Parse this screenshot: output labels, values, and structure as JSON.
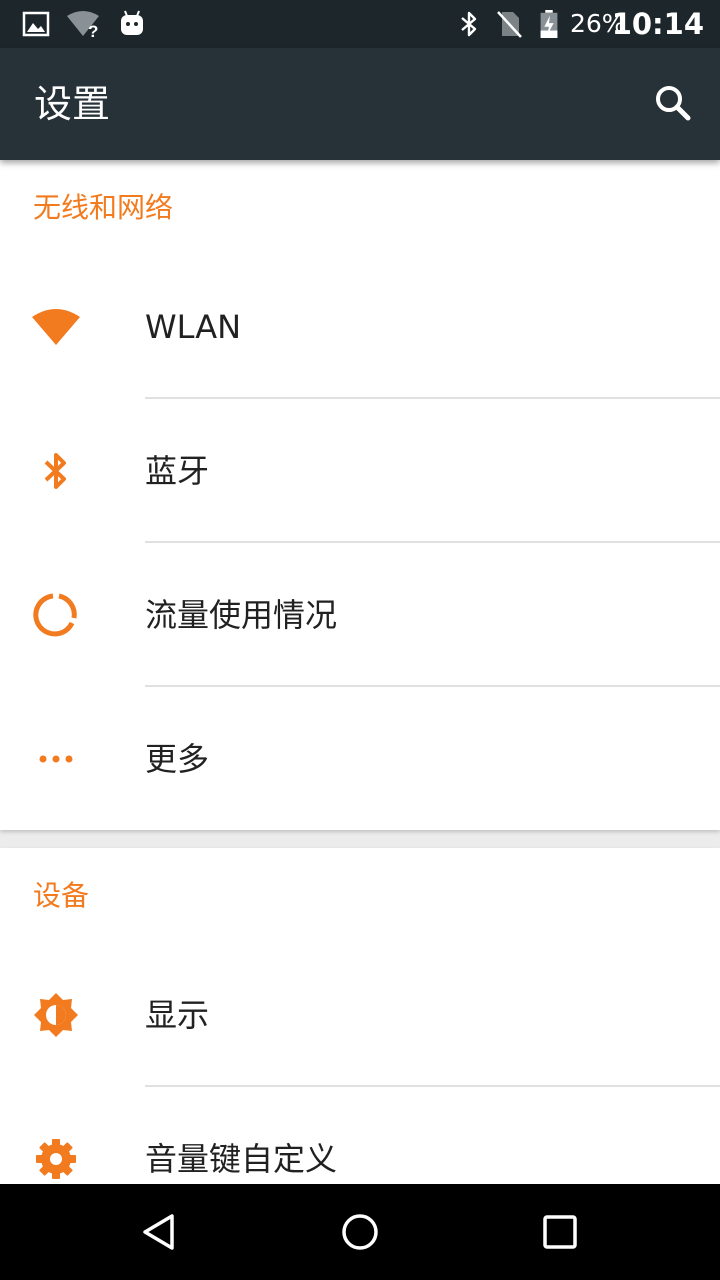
{
  "status_bar": {
    "battery_percent": "26%",
    "time": "10:14",
    "icons": [
      "image-icon",
      "wifi-unknown-icon",
      "android-debug-icon",
      "bluetooth-icon",
      "no-sim-icon",
      "battery-charging-icon"
    ]
  },
  "app_bar": {
    "title": "设置",
    "search_icon": "search-icon"
  },
  "sections": {
    "wireless": {
      "header": "无线和网络",
      "items": [
        {
          "label": "WLAN",
          "icon": "wifi-icon"
        },
        {
          "label": "蓝牙",
          "icon": "bluetooth-icon"
        },
        {
          "label": "流量使用情况",
          "icon": "data-usage-icon"
        },
        {
          "label": "更多",
          "icon": "more-dots-icon"
        }
      ]
    },
    "device": {
      "header": "设备",
      "items": [
        {
          "label": "显示",
          "icon": "brightness-icon"
        },
        {
          "label": "音量键自定义",
          "icon": "gear-icon"
        }
      ]
    }
  },
  "colors": {
    "accent": "#f27b1f",
    "app_bar": "#263238",
    "status_bar": "#1d272b"
  },
  "nav_bar": {
    "icons": [
      "back-icon",
      "home-icon",
      "recents-icon"
    ]
  }
}
